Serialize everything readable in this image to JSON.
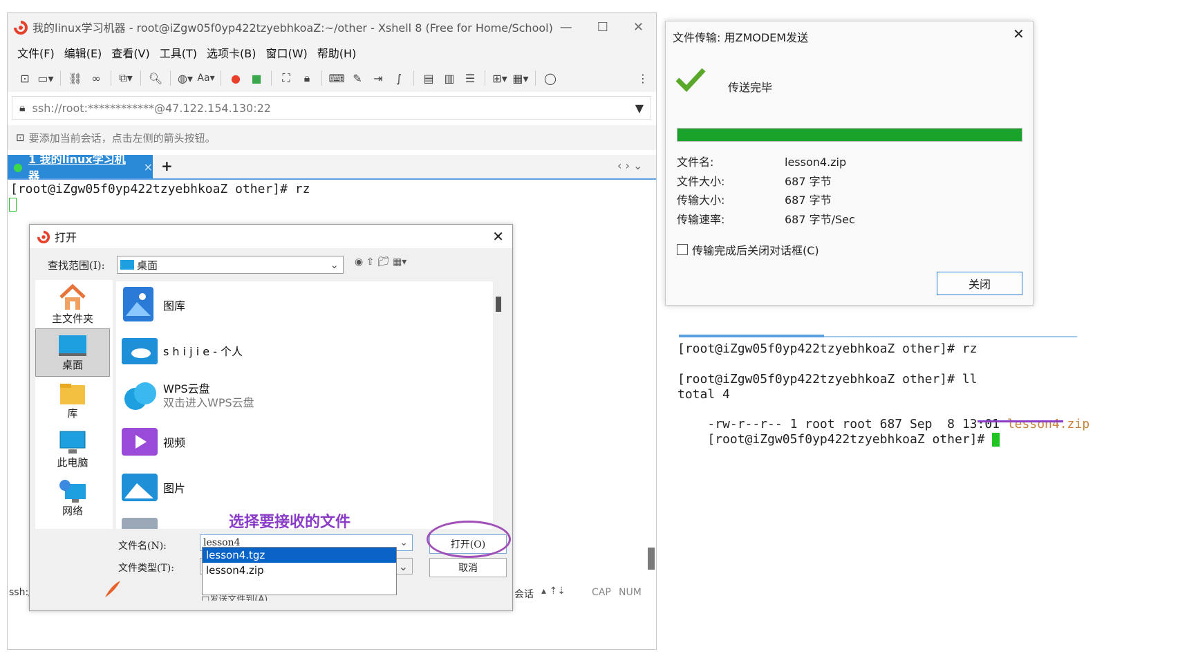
{
  "xshell": {
    "title": "我的linux学习机器 - root@iZgw05f0yp422tzyebhkoaZ:~/other - Xshell 8 (Free for Home/School)",
    "menu": [
      "文件(F)",
      "编辑(E)",
      "查看(V)",
      "工具(T)",
      "选项卡(B)",
      "窗口(W)",
      "帮助(H)"
    ],
    "address": "ssh://root:************@47.122.154.130:22",
    "hint": "要添加当前会话，点击左侧的箭头按钮。",
    "tab_label": "1 我的linux学习机器",
    "tab_close": "×",
    "tab_add": "+",
    "terminal_line": "[root@iZgw05f0yp422tzyebhkoaZ other]# rz",
    "status_left": "ssh:/",
    "status_session": "会话",
    "status_cap": "CAP",
    "status_num": "NUM"
  },
  "open_dialog": {
    "title": "打开",
    "lookin_label": "查找范围(I):",
    "lookin_value": "桌面",
    "places": [
      {
        "label": "主文件夹",
        "icon": "home-icon"
      },
      {
        "label": "桌面",
        "icon": "desktop-icon"
      },
      {
        "label": "库",
        "icon": "library-icon"
      },
      {
        "label": "此电脑",
        "icon": "computer-icon"
      },
      {
        "label": "网络",
        "icon": "network-icon"
      }
    ],
    "files": [
      {
        "name": "图库",
        "sub": ""
      },
      {
        "name": "s h i j i e - 个人",
        "sub": ""
      },
      {
        "name": "WPS云盘",
        "sub": "双击进入WPS云盘"
      },
      {
        "name": "视频",
        "sub": ""
      },
      {
        "name": "图片",
        "sub": ""
      }
    ],
    "annotation": "选择要接收的文件",
    "filename_label": "文件名(N):",
    "filename_value": "lesson4",
    "filetype_label": "文件类型(T):",
    "autocomplete": [
      "lesson4.tgz",
      "lesson4.zip"
    ],
    "open_button": "打开(O)",
    "cancel_button": "取消",
    "bottom_cut_text": "□发送文件到(A)"
  },
  "transfer_dialog": {
    "title": "文件传输: 用ZMODEM发送",
    "status": "传送完毕",
    "progress": 1.0,
    "rows": [
      {
        "key": "文件名:",
        "value": "lesson4.zip"
      },
      {
        "key": "文件大小:",
        "value": "687 字节"
      },
      {
        "key": "传输大小:",
        "value": "687 字节"
      },
      {
        "key": "传输速率:",
        "value": "687 字节/Sec"
      }
    ],
    "checkbox_label": "传输完成后关闭对话框(C)",
    "close_button": "关闭"
  },
  "terminal2": {
    "line1": "[root@iZgw05f0yp422tzyebhkoaZ other]# rz",
    "line2": "[root@iZgw05f0yp422tzyebhkoaZ other]# ll",
    "line3": "total 4",
    "line4_prefix": "-rw-r--r-- 1 root root 687 Sep  8 13:01 ",
    "line4_file": "lesson4.zip",
    "line5": "[root@iZgw05f0yp422tzyebhkoaZ other]# "
  },
  "colors": {
    "accent_blue": "#2a8ad8",
    "progress_green": "#1aa32a",
    "annotation_purple": "#8a3cc8",
    "file_orange": "#c8823a",
    "cursor_green": "#21c421"
  }
}
